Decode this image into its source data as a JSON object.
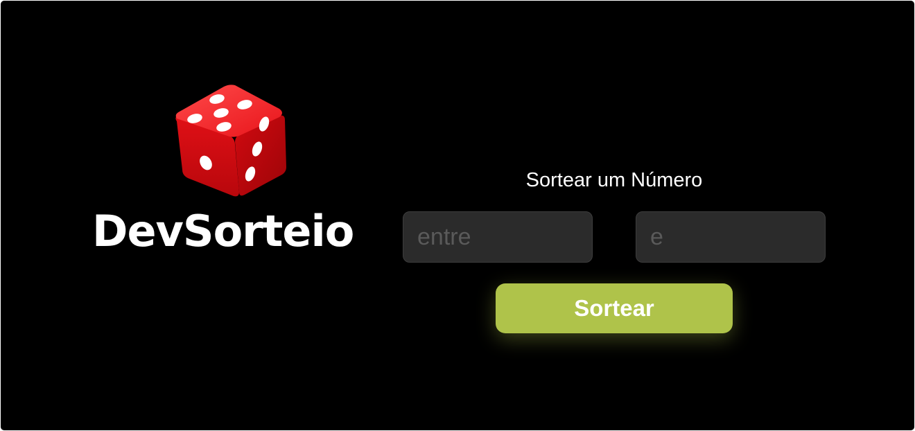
{
  "brand": {
    "name": "DevSorteio",
    "logo_icon": "dice-icon"
  },
  "form": {
    "title": "Sortear um Número",
    "min_field": {
      "placeholder": "entre",
      "value": ""
    },
    "max_field": {
      "placeholder": "e",
      "value": ""
    },
    "submit_label": "Sortear"
  },
  "colors": {
    "background": "#000000",
    "accent": "#afc34a",
    "input_background": "#2b2b2b",
    "dice_red": "#e8151b"
  }
}
